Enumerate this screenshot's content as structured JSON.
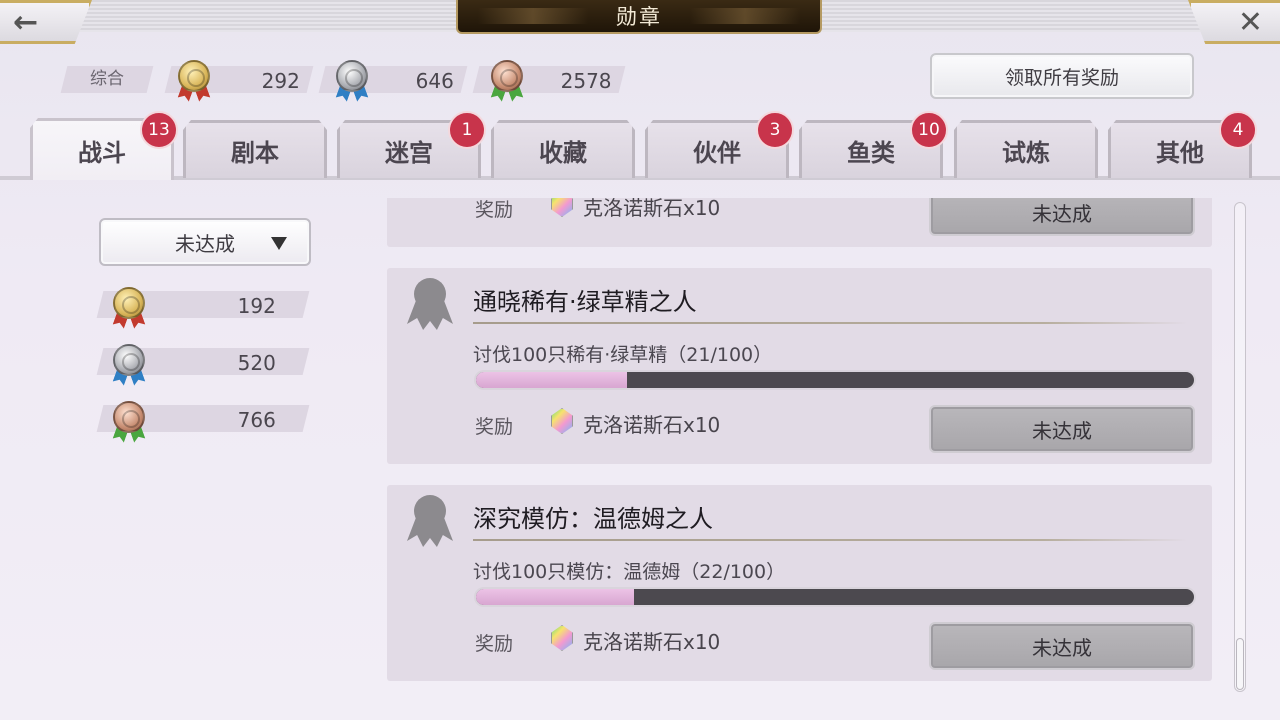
{
  "header": {
    "title": "勋章",
    "back_icon": "←",
    "close_icon": "✕"
  },
  "summary": {
    "label": "综合",
    "gold": "292",
    "silver": "646",
    "bronze": "2578"
  },
  "claim_all_label": "领取所有奖励",
  "tabs": [
    {
      "label": "战斗",
      "badge": "13",
      "active": true
    },
    {
      "label": "剧本",
      "badge": ""
    },
    {
      "label": "迷宫",
      "badge": "1"
    },
    {
      "label": "收藏",
      "badge": ""
    },
    {
      "label": "伙伴",
      "badge": "3"
    },
    {
      "label": "鱼类",
      "badge": "10"
    },
    {
      "label": "试炼",
      "badge": ""
    },
    {
      "label": "其他",
      "badge": "4"
    }
  ],
  "filter": {
    "selected": "未达成"
  },
  "side_counts": {
    "gold": "192",
    "silver": "520",
    "bronze": "766"
  },
  "colors": {
    "gold_coin": "#d9b65a",
    "gold_ribbon": "#c23a2e",
    "silver_coin": "#a9abb1",
    "silver_ribbon": "#2f7fc4",
    "bronze_coin": "#c78c71",
    "bronze_ribbon": "#4aa63f",
    "badge": "#c8344b",
    "progress_fill": "#d8a6d1"
  },
  "list": {
    "partial_card": {
      "reward_label": "奖励",
      "reward_item": "克洛诺斯石x10",
      "status": "未达成"
    },
    "cards": [
      {
        "title": "通晓稀有·绿草精之人",
        "desc": "讨伐100只稀有·绿草精（21/100）",
        "progress": 0.21,
        "reward_label": "奖励",
        "reward_item": "克洛诺斯石x10",
        "status": "未达成"
      },
      {
        "title": "深究模仿：温德姆之人",
        "desc": "讨伐100只模仿：温德姆（22/100）",
        "progress": 0.22,
        "reward_label": "奖励",
        "reward_item": "克洛诺斯石x10",
        "status": "未达成"
      }
    ]
  }
}
